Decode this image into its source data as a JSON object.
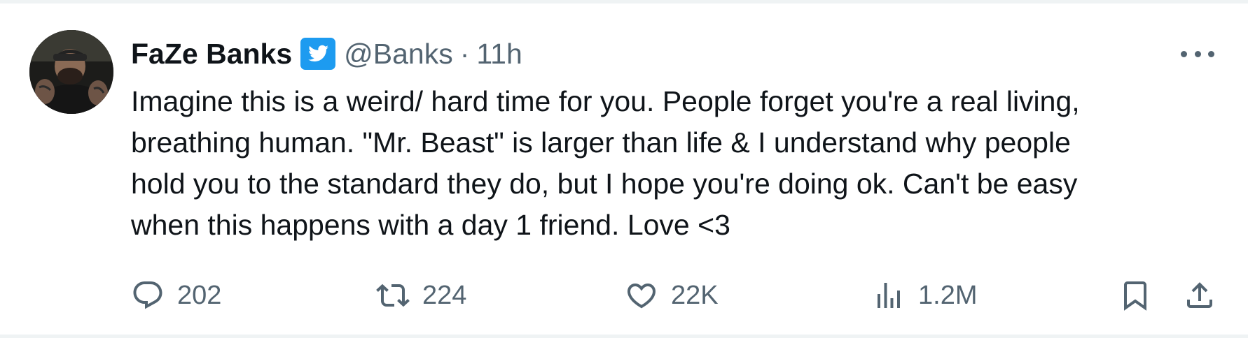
{
  "tweet": {
    "author_name": "FaZe Banks",
    "handle": "@Banks",
    "separator": "·",
    "time": "11h",
    "text_lines": [
      "Imagine this is a weird/ hard time for you. People forget you're a real living,",
      "breathing human. \"Mr. Beast\" is larger than life & I understand why people",
      "hold you to the standard they do, but I hope you're doing ok. Can't be easy",
      "when this happens with a day 1 friend. Love <3"
    ]
  },
  "actions": {
    "replies": "202",
    "retweets": "224",
    "likes": "22K",
    "views": "1.2M"
  },
  "icons": {
    "verified": "twitter-bird-verified-icon",
    "more": "more-dots-icon",
    "reply": "reply-icon",
    "retweet": "retweet-icon",
    "like": "heart-icon",
    "views": "views-icon",
    "bookmark": "bookmark-icon",
    "share": "share-icon"
  },
  "colors": {
    "text": "#0f1419",
    "secondary": "#536471",
    "verified_blue": "#1d9bf0",
    "divider": "#eff3f4"
  }
}
